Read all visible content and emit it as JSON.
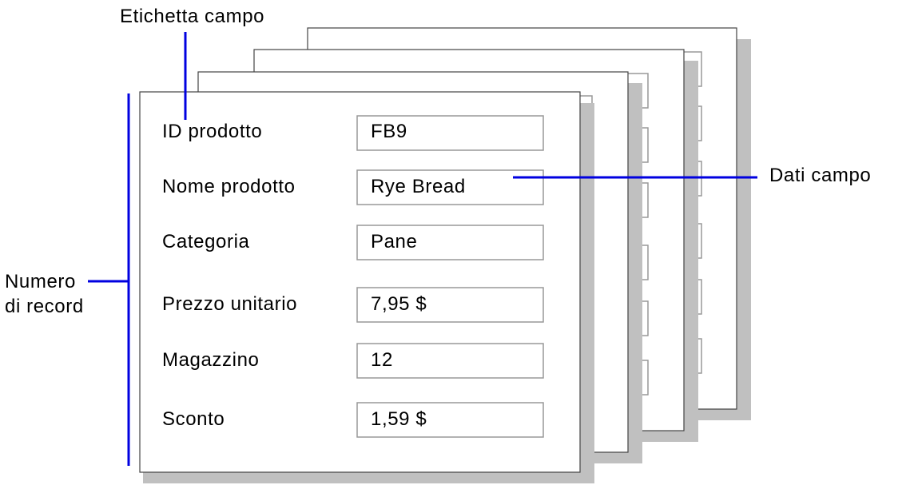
{
  "callouts": {
    "field_label": "Etichetta campo",
    "field_data": "Dati campo",
    "record_number_line1": "Numero",
    "record_number_line2": "di record"
  },
  "record": {
    "fields": [
      {
        "label": "ID prodotto",
        "value": "FB9"
      },
      {
        "label": "Nome prodotto",
        "value": "Rye Bread"
      },
      {
        "label": "Categoria",
        "value": "Pane"
      },
      {
        "label": "Prezzo unitario",
        "value": "7,95 $"
      },
      {
        "label": "Magazzino",
        "value": "12"
      },
      {
        "label": "Sconto",
        "value": "1,59 $"
      }
    ]
  },
  "stacked_records_count": 4,
  "colors": {
    "callout": "#0000e0",
    "shadow": "#c0c0c0"
  }
}
